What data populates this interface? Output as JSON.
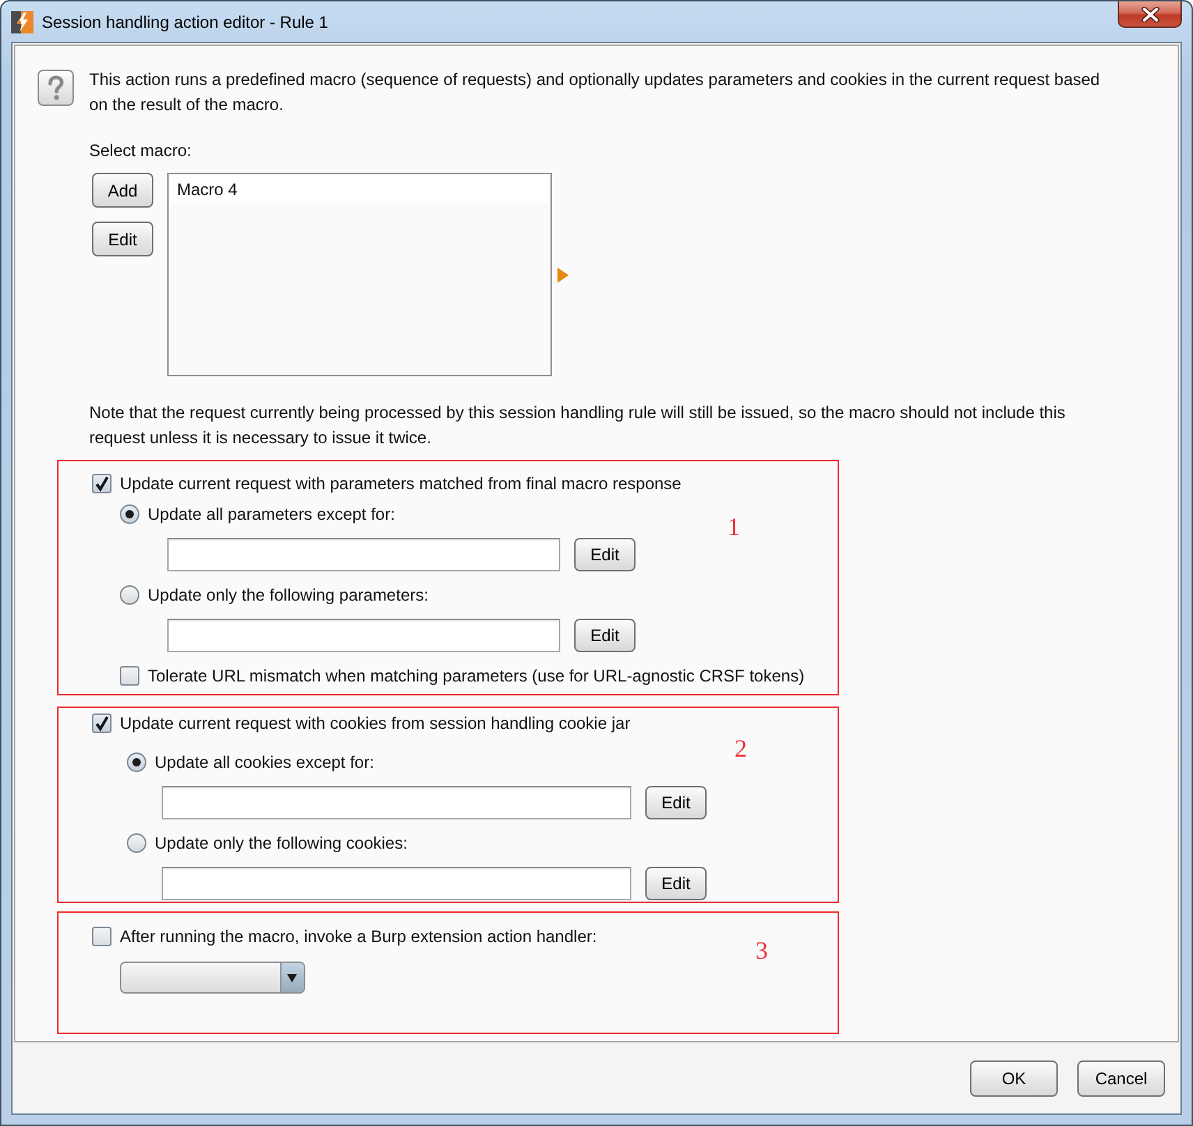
{
  "window": {
    "title": "Session handling action editor - Rule 1"
  },
  "description": "This action runs a predefined macro (sequence of requests) and optionally updates parameters and cookies in the current request based on the result of the macro.",
  "macro": {
    "label": "Select macro:",
    "buttons": [
      "Add",
      "Edit"
    ],
    "items": [
      {
        "label": "Macro 4",
        "selected": false
      }
    ]
  },
  "note": "Note that the request currently being processed by this session handling rule will still be issued, so the macro should not include this request unless it is necessary to issue it twice.",
  "sections": [
    {
      "annotation": "1",
      "options": [
        {
          "kind": "checkbox",
          "label": "Update current request with parameters matched from final macro response",
          "checked": true,
          "children": [
            {
              "kind": "radio",
              "label": "Update all parameters except for:",
              "selected": true,
              "children": [
                {
                  "kind": "field",
                  "button": "Edit"
                }
              ]
            },
            {
              "kind": "radio",
              "label": "Update only the following parameters:",
              "selected": false,
              "children": [
                {
                  "kind": "field",
                  "button": "Edit"
                }
              ]
            },
            {
              "kind": "checkbox",
              "label": "Tolerate URL mismatch when matching parameters (use for URL-agnostic CRSF tokens)",
              "checked": false
            }
          ]
        }
      ]
    },
    {
      "annotation": "2",
      "options": [
        {
          "kind": "checkbox",
          "label": "Update current request with cookies from session handling cookie jar",
          "checked": true,
          "children": [
            {
              "kind": "radio",
              "label": "Update all cookies except for:",
              "selected": true,
              "children": [
                {
                  "kind": "field",
                  "button": "Edit"
                }
              ]
            },
            {
              "kind": "radio",
              "label": "Update only the following cookies:",
              "selected": false,
              "children": [
                {
                  "kind": "field",
                  "button": "Edit"
                }
              ]
            }
          ]
        }
      ]
    },
    {
      "annotation": "3",
      "options": [
        {
          "kind": "checkbox",
          "label": "After running the macro, invoke a Burp extension action handler:",
          "checked": false,
          "children": [
            {
              "kind": "dropdown"
            }
          ]
        }
      ]
    }
  ],
  "buttons": [
    "OK",
    "Cancel"
  ]
}
